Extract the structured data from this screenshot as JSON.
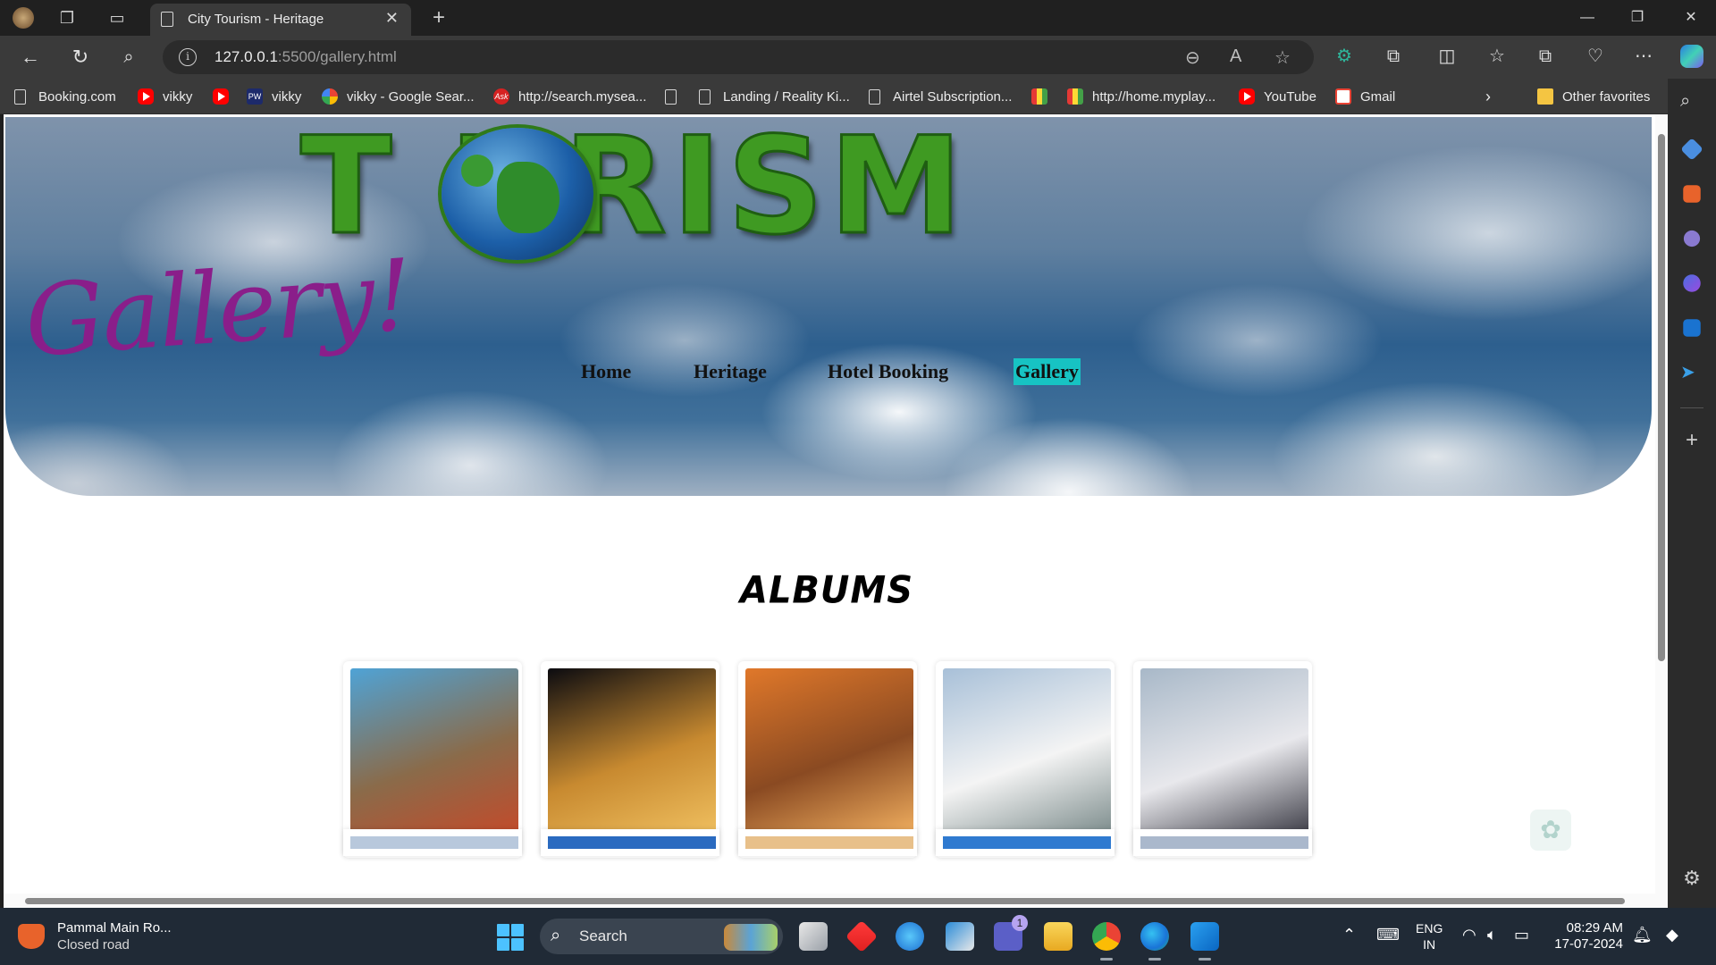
{
  "browser": {
    "tab_title": "City Tourism - Heritage",
    "url_host": "127.0.0.1",
    "url_rest": ":5500/gallery.html",
    "favorites": [
      {
        "label": "Booking.com",
        "icon": "page-icon"
      },
      {
        "label": "vikky",
        "icon": "youtube-icon"
      },
      {
        "label": "",
        "icon": "youtube-icon"
      },
      {
        "label": "vikky",
        "icon": "physics-wallah-icon"
      },
      {
        "label": "vikky - Google Sear...",
        "icon": "google-icon"
      },
      {
        "label": "http://search.mysea...",
        "icon": "ask-icon"
      },
      {
        "label": "",
        "icon": "page-icon"
      },
      {
        "label": "Landing / Reality Ki...",
        "icon": "page-icon"
      },
      {
        "label": "Airtel Subscription...",
        "icon": "page-icon"
      },
      {
        "label": "",
        "icon": "myplay-icon"
      },
      {
        "label": "http://home.myplay...",
        "icon": "myplay-icon"
      },
      {
        "label": "YouTube",
        "icon": "youtube-icon"
      },
      {
        "label": "Gmail",
        "icon": "gmail-icon"
      }
    ],
    "other_favorites": "Other favorites"
  },
  "page": {
    "banner_word": "T URISM",
    "script_title": "Gallery!",
    "nav": [
      "Home",
      "Heritage",
      "Hotel Booking",
      "Gallery"
    ],
    "active_nav": "Gallery",
    "albums_heading": "ALBUMS",
    "album_colors": [
      [
        "#4fa3d6",
        "#8a6b4a",
        "#c44a2a"
      ],
      [
        "#0b0b10",
        "#c88a30",
        "#f0c060"
      ],
      [
        "#e0782a",
        "#8a4a22",
        "#f2b060"
      ],
      [
        "#a8c0d8",
        "#f4f4f4",
        "#7a8a8a"
      ],
      [
        "#a8b8c8",
        "#e8e8ec",
        "#3a3a44"
      ]
    ],
    "row2_colors": [
      "#b8c8dc",
      "#2a6ac0",
      "#e8c08a",
      "#2f7ad0",
      "#aab8cc"
    ]
  },
  "taskbar": {
    "weather_line1": "Pammal Main Ro...",
    "weather_line2": "Closed road",
    "search_label": "Search",
    "lang_line1": "ENG",
    "lang_line2": "IN",
    "time": "08:29 AM",
    "date": "17-07-2024",
    "teams_badge": "1"
  }
}
